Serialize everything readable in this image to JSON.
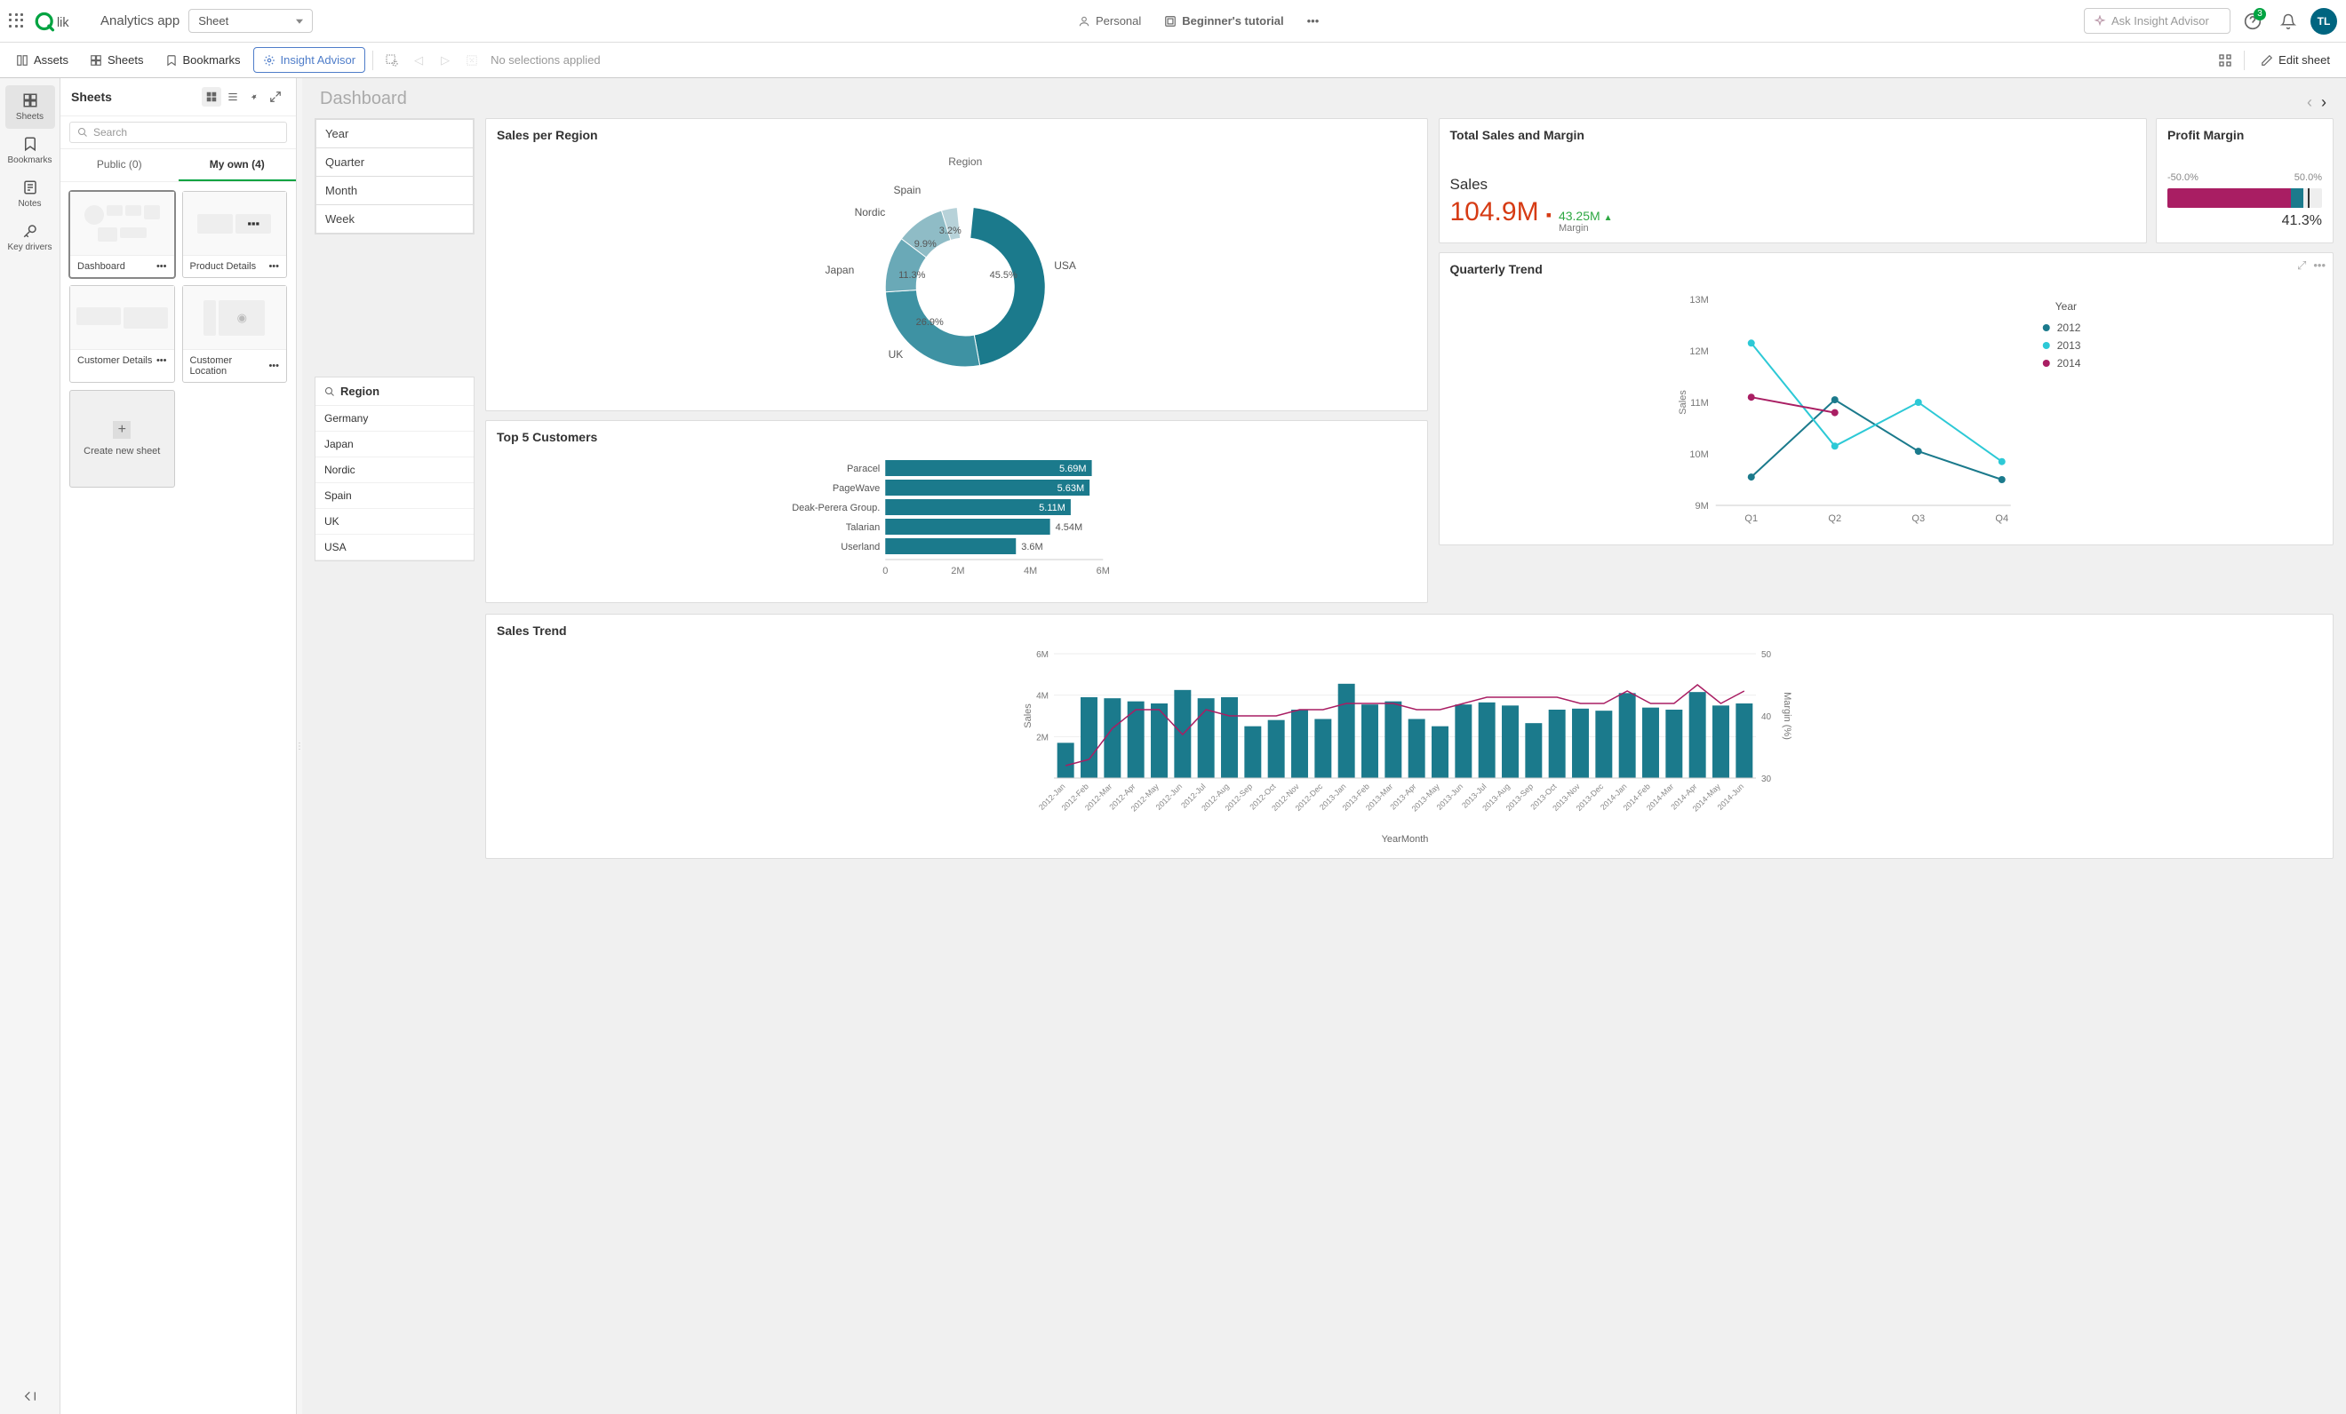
{
  "topbar": {
    "app_name": "Analytics app",
    "sheet_dd": "Sheet",
    "personal": "Personal",
    "tutorial": "Beginner's tutorial",
    "ask_placeholder": "Ask Insight Advisor",
    "help_badge": "3",
    "avatar": "TL"
  },
  "toolbar": {
    "assets": "Assets",
    "sheets": "Sheets",
    "bookmarks": "Bookmarks",
    "insight": "Insight Advisor",
    "nosel": "No selections applied",
    "edit": "Edit sheet"
  },
  "rail": {
    "sheets": "Sheets",
    "bookmarks": "Bookmarks",
    "notes": "Notes",
    "keydrivers": "Key drivers"
  },
  "sheets_panel": {
    "title": "Sheets",
    "search_placeholder": "Search",
    "tab_public": "Public (0)",
    "tab_myown": "My own (4)",
    "thumbs": [
      {
        "name": "Dashboard",
        "selected": true
      },
      {
        "name": "Product Details",
        "selected": false
      },
      {
        "name": "Customer Details",
        "selected": false
      },
      {
        "name": "Customer Location",
        "selected": false
      }
    ],
    "new_sheet": "Create new sheet"
  },
  "canvas": {
    "title": "Dashboard"
  },
  "filters_time": [
    "Year",
    "Quarter",
    "Month",
    "Week"
  ],
  "region_filter": {
    "title": "Region",
    "items": [
      "Germany",
      "Japan",
      "Nordic",
      "Spain",
      "UK",
      "USA"
    ]
  },
  "sales_region": {
    "title": "Sales per Region",
    "legend": "Region",
    "slices": [
      {
        "label": "USA",
        "pct": "45.5%"
      },
      {
        "label": "UK",
        "pct": "26.9%"
      },
      {
        "label": "Japan",
        "pct": "11.3%"
      },
      {
        "label": "Nordic",
        "pct": "9.9%"
      },
      {
        "label": "Spain",
        "pct": "3.2%"
      }
    ]
  },
  "top5": {
    "title": "Top 5 Customers",
    "bars": [
      {
        "name": "Paracel",
        "val": 5.69,
        "lbl": "5.69M"
      },
      {
        "name": "PageWave",
        "val": 5.63,
        "lbl": "5.63M"
      },
      {
        "name": "Deak-Perera Group.",
        "val": 5.11,
        "lbl": "5.11M"
      },
      {
        "name": "Talarian",
        "val": 4.54,
        "lbl": "4.54M"
      },
      {
        "name": "Userland",
        "val": 3.6,
        "lbl": "3.6M"
      }
    ],
    "xticks": [
      "0",
      "2M",
      "4M",
      "6M"
    ]
  },
  "kpi": {
    "title": "Total Sales and Margin",
    "label": "Sales",
    "value": "104.9M",
    "sub_val": "43.25M",
    "sub_lbl": "Margin",
    "arrow": "▲"
  },
  "pm": {
    "title": "Profit Margin",
    "min": "-50.0%",
    "max": "50.0%",
    "value": "41.3%"
  },
  "quarterly": {
    "title": "Quarterly Trend",
    "legend_title": "Year",
    "legend": [
      "2012",
      "2013",
      "2014"
    ],
    "x": [
      "Q1",
      "Q2",
      "Q3",
      "Q4"
    ],
    "yticks": [
      "9M",
      "10M",
      "11M",
      "12M",
      "13M"
    ],
    "ylabel": "Sales"
  },
  "sales_trend": {
    "title": "Sales Trend",
    "ylabel": "Sales",
    "y2label": "Margin (%)",
    "yticks": [
      "2M",
      "4M",
      "6M"
    ],
    "y2ticks": [
      "30",
      "40",
      "50"
    ],
    "xlabel": "YearMonth",
    "months": [
      "2012-Jan",
      "2012-Feb",
      "2012-Mar",
      "2012-Apr",
      "2012-May",
      "2012-Jun",
      "2012-Jul",
      "2012-Aug",
      "2012-Sep",
      "2012-Oct",
      "2012-Nov",
      "2012-Dec",
      "2013-Jan",
      "2013-Feb",
      "2013-Mar",
      "2013-Apr",
      "2013-May",
      "2013-Jun",
      "2013-Jul",
      "2013-Aug",
      "2013-Sep",
      "2013-Oct",
      "2013-Nov",
      "2013-Dec",
      "2014-Jan",
      "2014-Feb",
      "2014-Mar",
      "2014-Apr",
      "2014-May",
      "2014-Jun"
    ]
  },
  "chart_data": [
    {
      "type": "pie",
      "title": "Sales per Region",
      "categories": [
        "USA",
        "UK",
        "Japan",
        "Nordic",
        "Spain"
      ],
      "values": [
        45.5,
        26.9,
        11.3,
        9.9,
        3.2
      ]
    },
    {
      "type": "bar",
      "title": "Top 5 Customers",
      "categories": [
        "Paracel",
        "PageWave",
        "Deak-Perera Group.",
        "Talarian",
        "Userland"
      ],
      "values": [
        5.69,
        5.63,
        5.11,
        4.54,
        3.6
      ],
      "xlabel": "",
      "ylabel": "",
      "ylim": [
        0,
        6
      ]
    },
    {
      "type": "line",
      "title": "Quarterly Trend",
      "categories": [
        "Q1",
        "Q2",
        "Q3",
        "Q4"
      ],
      "series": [
        {
          "name": "2012",
          "values": [
            9.55,
            11.05,
            10.05,
            9.5
          ]
        },
        {
          "name": "2013",
          "values": [
            12.15,
            10.15,
            11.0,
            9.85
          ]
        },
        {
          "name": "2014",
          "values": [
            11.1,
            10.8,
            null,
            null
          ]
        }
      ],
      "ylim": [
        9,
        13
      ],
      "ylabel": "Sales"
    },
    {
      "type": "bar",
      "title": "Sales Trend",
      "categories": [
        "2012-Jan",
        "2012-Feb",
        "2012-Mar",
        "2012-Apr",
        "2012-May",
        "2012-Jun",
        "2012-Jul",
        "2012-Aug",
        "2012-Sep",
        "2012-Oct",
        "2012-Nov",
        "2012-Dec",
        "2013-Jan",
        "2013-Feb",
        "2013-Mar",
        "2013-Apr",
        "2013-May",
        "2013-Jun",
        "2013-Jul",
        "2013-Aug",
        "2013-Sep",
        "2013-Oct",
        "2013-Nov",
        "2013-Dec",
        "2014-Jan",
        "2014-Feb",
        "2014-Mar",
        "2014-Apr",
        "2014-May",
        "2014-Jun"
      ],
      "series": [
        {
          "name": "Sales",
          "values": [
            1.7,
            3.9,
            3.85,
            3.7,
            3.6,
            4.25,
            3.85,
            3.9,
            2.5,
            2.8,
            3.3,
            2.85,
            4.55,
            3.55,
            3.7,
            2.85,
            2.5,
            3.55,
            3.65,
            3.5,
            2.65,
            3.3,
            3.35,
            3.25,
            4.1,
            3.4,
            3.3,
            4.15,
            3.5,
            3.6
          ]
        },
        {
          "name": "Margin (%)",
          "values": [
            32,
            33,
            38,
            41,
            41,
            37,
            41,
            40,
            40,
            40,
            41,
            41,
            42,
            42,
            42,
            41,
            41,
            42,
            43,
            43,
            43,
            43,
            42,
            42,
            44,
            42,
            42,
            45,
            42,
            44
          ]
        }
      ],
      "ylim": [
        0,
        6
      ],
      "y2lim": [
        30,
        50
      ],
      "ylabel": "Sales",
      "y2label": "Margin (%)",
      "xlabel": "YearMonth"
    }
  ]
}
